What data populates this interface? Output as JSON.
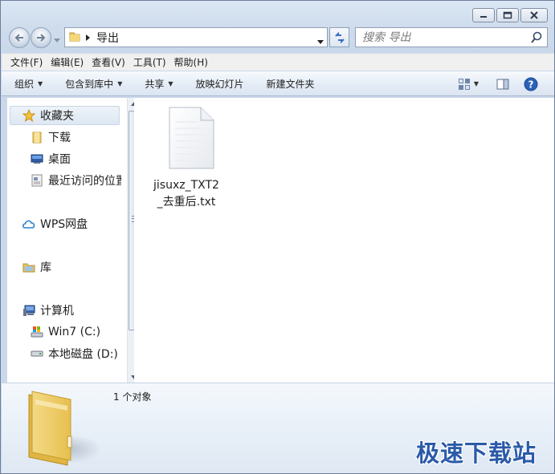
{
  "address": {
    "crumb": "导出"
  },
  "search": {
    "placeholder": "搜索 导出"
  },
  "menu": [
    "文件(F)",
    "编辑(E)",
    "查看(V)",
    "工具(T)",
    "帮助(H)"
  ],
  "commands": {
    "organize": "组织",
    "include_in_library": "包含到库中",
    "share": "共享",
    "slideshow": "放映幻灯片",
    "new_folder": "新建文件夹"
  },
  "nav": {
    "favorites": "收藏夹",
    "downloads": "下载",
    "desktop": "桌面",
    "recent": "最近访问的位置",
    "wps": "WPS网盘",
    "libraries": "库",
    "computer": "计算机",
    "win7": "Win7 (C:)",
    "local_disk": "本地磁盘 (D:)"
  },
  "files": [
    {
      "name": "jisuxz_TXT2_去重后.txt",
      "icon": "text-file-icon"
    }
  ],
  "details": {
    "count": "1 个对象"
  },
  "watermark": "极速下载站",
  "colors": {
    "accent": "#2a5aa8",
    "selection": "#dde7f2"
  }
}
